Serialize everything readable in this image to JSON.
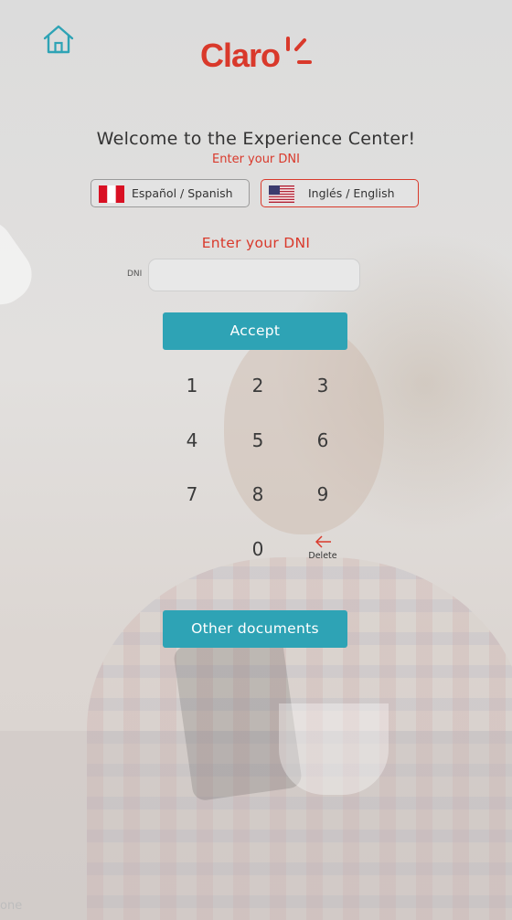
{
  "brand": {
    "logo_text": "Claro",
    "accent_color": "#d9392b",
    "button_color": "#2ea3b5"
  },
  "header": {
    "home_icon": "home-icon"
  },
  "welcome": {
    "title": "Welcome to the Experience Center!",
    "subtitle": "Enter your DNI"
  },
  "languages": [
    {
      "label": "Español / Spanish",
      "flag": "peru-flag-icon",
      "selected": false
    },
    {
      "label": "Inglés / English",
      "flag": "usa-flag-icon",
      "selected": true
    }
  ],
  "dni": {
    "heading": "Enter your DNI",
    "label": "DNI",
    "value": "",
    "placeholder": ""
  },
  "actions": {
    "accept": "Accept",
    "other_documents": "Other documents"
  },
  "keypad": {
    "keys": [
      "1",
      "2",
      "3",
      "4",
      "5",
      "6",
      "7",
      "8",
      "9",
      "0"
    ],
    "delete_label": "Delete",
    "delete_icon": "arrow-left-icon"
  },
  "watermark": "one"
}
